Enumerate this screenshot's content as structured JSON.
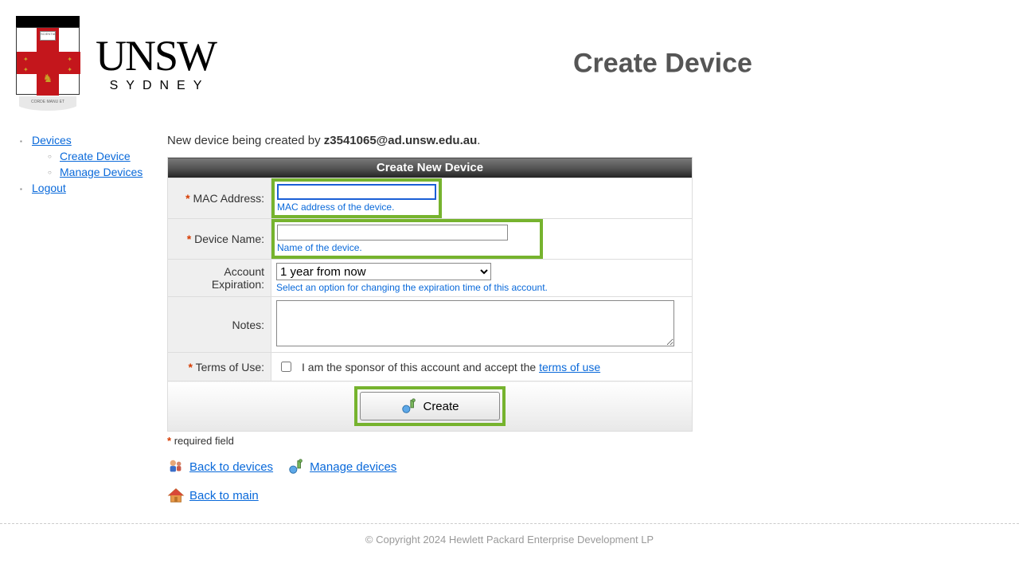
{
  "brand": {
    "name": "UNSW",
    "sub": "SYDNEY",
    "crest_book": "SCIENTIA",
    "crest_ribbon": "CORDE MANU ET"
  },
  "page_title": "Create Device",
  "sidebar": {
    "items": [
      {
        "label": "Devices"
      },
      {
        "label": "Create Device"
      },
      {
        "label": "Manage Devices"
      },
      {
        "label": "Logout"
      }
    ]
  },
  "intro": {
    "prefix": "New device being created by ",
    "user": "z3541065@ad.unsw.edu.au",
    "suffix": "."
  },
  "form": {
    "header": "Create New Device",
    "mac": {
      "label": "MAC Address:",
      "value": "",
      "help": "MAC address of the device."
    },
    "device_name": {
      "label": "Device Name:",
      "value": "",
      "help": "Name of the device."
    },
    "expiration": {
      "label": "Account Expiration:",
      "selected": "1 year from now",
      "help": "Select an option for changing the expiration time of this account."
    },
    "notes": {
      "label": "Notes:",
      "value": ""
    },
    "terms": {
      "label": "Terms of Use:",
      "text_prefix": "I am the sponsor of this account and accept the ",
      "link_text": "terms of use",
      "checked": false
    },
    "submit": {
      "label": "Create"
    }
  },
  "required_note": "required field",
  "links": {
    "back_devices": "Back to devices",
    "manage_devices": "Manage devices",
    "back_main": "Back to main"
  },
  "footer": "© Copyright 2024 Hewlett Packard Enterprise Development LP"
}
